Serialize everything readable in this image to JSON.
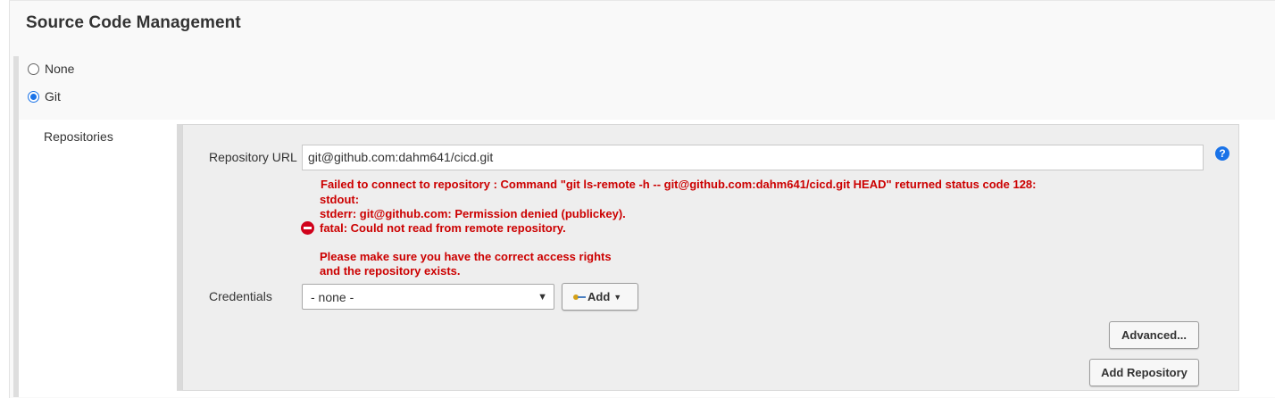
{
  "section": {
    "title": "Source Code Management"
  },
  "scm_options": [
    {
      "label": "None",
      "selected": false
    },
    {
      "label": "Git",
      "selected": true
    }
  ],
  "repositories": {
    "label": "Repositories",
    "url_label": "Repository URL",
    "url_value": "git@github.com:dahm641/cicd.git",
    "error_lines": [
      "Failed to connect to repository : Command \"git ls-remote -h -- git@github.com:dahm641/cicd.git HEAD\" returned status code 128:",
      "stdout:",
      "stderr: git@github.com: Permission denied (publickey).",
      "fatal: Could not read from remote repository.",
      "Please make sure you have the correct access rights",
      "and the repository exists."
    ],
    "credentials_label": "Credentials",
    "credentials_selected": "- none -",
    "add_label": "Add",
    "advanced_label": "Advanced...",
    "add_repository_label": "Add Repository"
  },
  "help_glyph": "?",
  "colors": {
    "error": "#cc0000",
    "accent": "#1a73e8"
  },
  "icons": [
    "help-icon",
    "error-icon",
    "key-icon",
    "caret-down-icon"
  ]
}
